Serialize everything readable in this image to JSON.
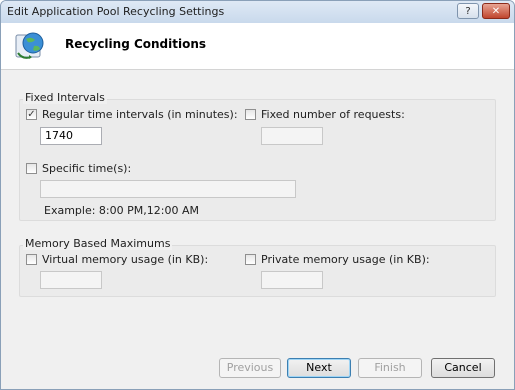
{
  "window": {
    "title": "Edit Application Pool Recycling Settings",
    "help_glyph": "?",
    "close_glyph": "✕"
  },
  "header": {
    "title": "Recycling Conditions"
  },
  "fixed_intervals": {
    "group_label": "Fixed Intervals",
    "regular_time": {
      "label": "Regular time intervals (in minutes):",
      "checked": true,
      "value": "1740"
    },
    "fixed_requests": {
      "label": "Fixed number of requests:",
      "checked": false,
      "value": ""
    },
    "specific_times": {
      "label": "Specific time(s):",
      "checked": false,
      "value": ""
    },
    "example": "Example: 8:00 PM,12:00 AM"
  },
  "memory": {
    "group_label": "Memory Based Maximums",
    "virtual": {
      "label": "Virtual memory usage (in KB):",
      "checked": false,
      "value": ""
    },
    "private": {
      "label": "Private memory usage (in KB):",
      "checked": false,
      "value": ""
    }
  },
  "buttons": {
    "previous": "Previous",
    "next": "Next",
    "finish": "Finish",
    "cancel": "Cancel"
  },
  "icons": {
    "header": "globe-recycle-icon",
    "checkmark": "✓"
  }
}
